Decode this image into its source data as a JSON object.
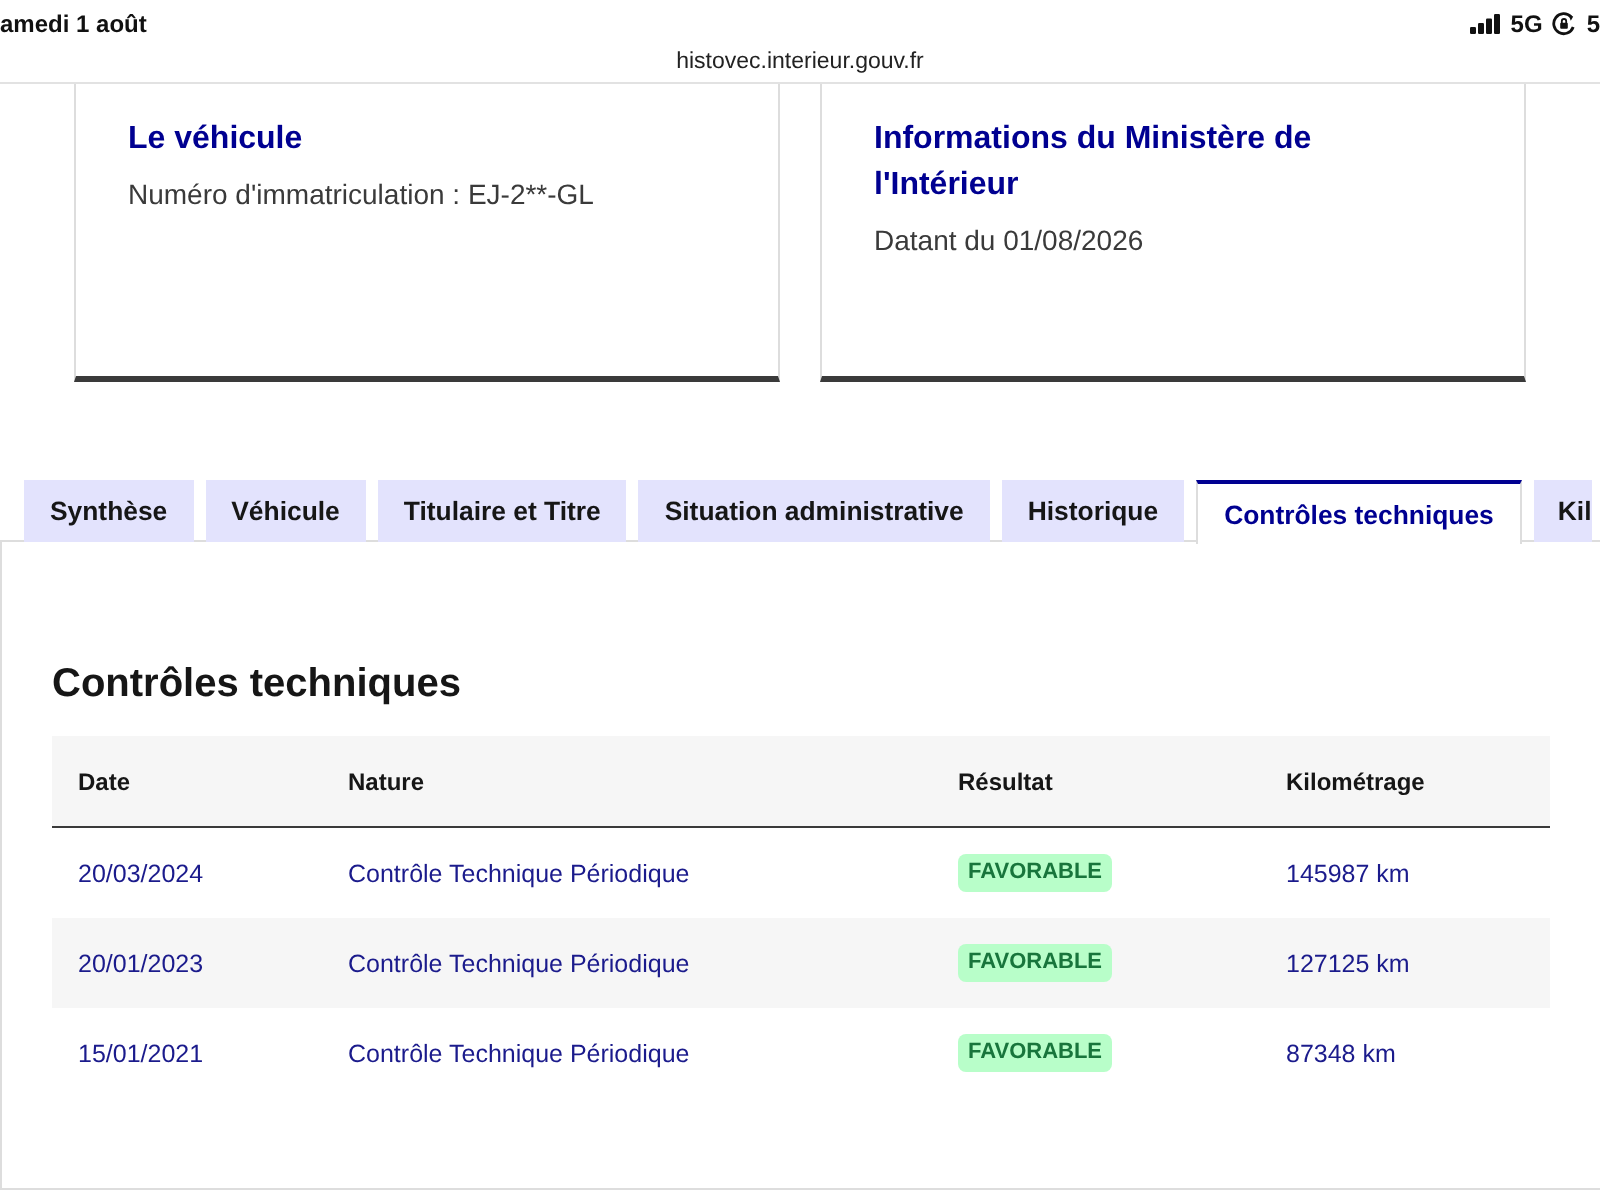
{
  "status_bar": {
    "date": "amedi 1 août",
    "network": "5G",
    "battery": "5"
  },
  "address_bar": {
    "url": "histovec.interieur.gouv.fr"
  },
  "cards": [
    {
      "title": "Le véhicule",
      "detail": "Numéro d'immatriculation : EJ-2**-GL"
    },
    {
      "title": "Informations du Ministère de l'Intérieur",
      "detail": "Datant du 01/08/2026"
    }
  ],
  "tabs": [
    {
      "label": "Synthèse",
      "selected": false
    },
    {
      "label": "Véhicule",
      "selected": false
    },
    {
      "label": "Titulaire et Titre",
      "selected": false
    },
    {
      "label": "Situation administrative",
      "selected": false
    },
    {
      "label": "Historique",
      "selected": false
    },
    {
      "label": "Contrôles techniques",
      "selected": true
    },
    {
      "label": "Kil",
      "selected": false
    }
  ],
  "section": {
    "title": "Contrôles techniques",
    "table": {
      "columns": [
        "Date",
        "Nature",
        "Résultat",
        "Kilométrage"
      ],
      "rows": [
        {
          "date": "20/03/2024",
          "nature": "Contrôle Technique Périodique",
          "result": "FAVORABLE",
          "mileage": "145987 km"
        },
        {
          "date": "20/01/2023",
          "nature": "Contrôle Technique Périodique",
          "result": "FAVORABLE",
          "mileage": "127125 km"
        },
        {
          "date": "15/01/2021",
          "nature": "Contrôle Technique Périodique",
          "result": "FAVORABLE",
          "mileage": "87348 km"
        }
      ]
    }
  }
}
